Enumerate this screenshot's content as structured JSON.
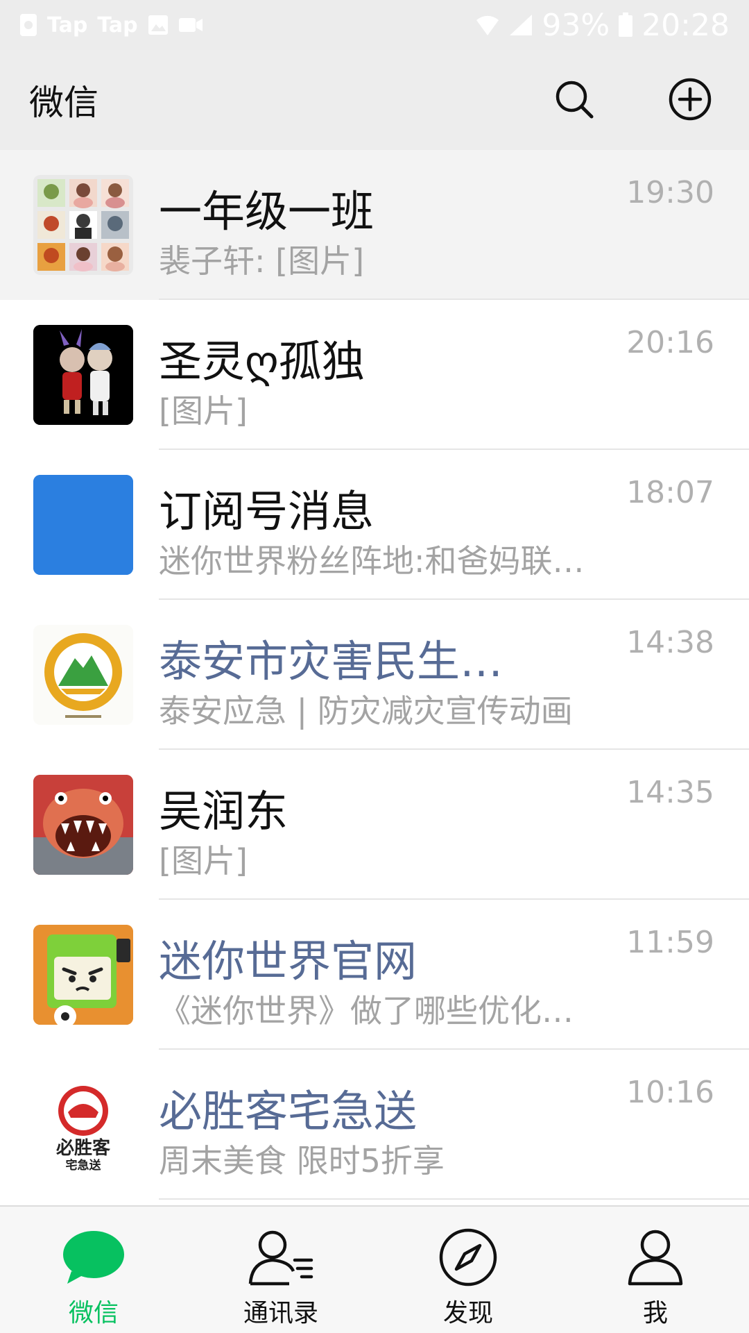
{
  "status_bar": {
    "notif_texts": [
      "Tap",
      "Tap"
    ],
    "battery_percent": "93%",
    "time": "20:28"
  },
  "topbar": {
    "title": "微信",
    "search_icon": "search-icon",
    "add_icon": "plus-circle-icon"
  },
  "chats": [
    {
      "name": "一年级一班",
      "preview": "裴子轩: [图片]",
      "time": "19:30",
      "official": false,
      "pinned": true
    },
    {
      "name": "圣灵ღ孤独",
      "preview": "[图片]",
      "time": "20:16",
      "official": false,
      "pinned": false
    },
    {
      "name": "订阅号消息",
      "preview": "迷你世界粉丝阵地:和爸妈联…",
      "time": "18:07",
      "official": false,
      "pinned": false
    },
    {
      "name": "泰安市灾害民生…",
      "preview": "泰安应急 | 防灾减灾宣传动画",
      "time": "14:38",
      "official": true,
      "pinned": false
    },
    {
      "name": "吴润东",
      "preview": "[图片]",
      "time": "14:35",
      "official": false,
      "pinned": false
    },
    {
      "name": "迷你世界官网",
      "preview": "《迷你世界》做了哪些优化…",
      "time": "11:59",
      "official": true,
      "pinned": false
    },
    {
      "name": "必胜客宅急送",
      "preview": "周末美食 限时5折享",
      "time": "10:16",
      "official": true,
      "pinned": false
    }
  ],
  "avatar_logo_text": {
    "pizza_line1": "必胜客",
    "pizza_line2": "宅急送"
  },
  "tabs": [
    {
      "label": "微信",
      "icon": "chat-bubble-icon",
      "active": true
    },
    {
      "label": "通讯录",
      "icon": "contacts-icon",
      "active": false
    },
    {
      "label": "发现",
      "icon": "compass-icon",
      "active": false
    },
    {
      "label": "我",
      "icon": "person-icon",
      "active": false
    }
  ],
  "colors": {
    "accent_green": "#07c160",
    "official_blue": "#576b95",
    "timestamp_gray": "#b0b0b0",
    "preview_gray": "#a3a3a3",
    "header_bg": "#ededed"
  }
}
